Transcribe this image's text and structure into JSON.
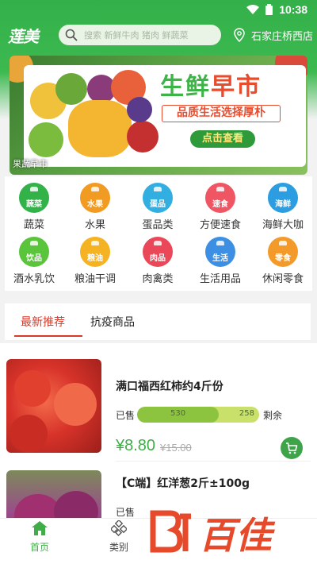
{
  "status_bar": {
    "time": "10:38"
  },
  "header": {
    "logo": "莲美",
    "search_placeholder": "搜索 新鲜牛肉 猪肉 鲜蔬菜",
    "location": "石家庄桥西店"
  },
  "banner": {
    "title_a": "生鲜",
    "title_b": "早市",
    "subtitle": "品质生活选择厚朴",
    "cta": "点击查看",
    "caption": "果蔬早市"
  },
  "categories": [
    {
      "badge": "蔬菜",
      "label": "蔬菜",
      "color": "#33b24a"
    },
    {
      "badge": "水果",
      "label": "水果",
      "color": "#f29b22"
    },
    {
      "badge": "蛋品",
      "label": "蛋品类",
      "color": "#33aee0"
    },
    {
      "badge": "速食",
      "label": "方便速食",
      "color": "#ef5563"
    },
    {
      "badge": "海鲜",
      "label": "海鲜大咖",
      "color": "#2b9de0"
    },
    {
      "badge": "饮品",
      "label": "酒水乳饮",
      "color": "#5ac43a"
    },
    {
      "badge": "粮油",
      "label": "粮油干调",
      "color": "#f5b324"
    },
    {
      "badge": "肉品",
      "label": "肉禽类",
      "color": "#ea4758"
    },
    {
      "badge": "生活",
      "label": "生活用品",
      "color": "#3d8fe4"
    },
    {
      "badge": "零食",
      "label": "休闲零食",
      "color": "#f49a2a"
    }
  ],
  "tabs": [
    {
      "label": "最新推荐",
      "active": true
    },
    {
      "label": "抗疫商品",
      "active": false
    }
  ],
  "products": [
    {
      "name": "满口福西红柿约4斤份",
      "sold_label": "已售",
      "sold": "530",
      "stock": "258",
      "remain_label": "剩余",
      "sold_fraction": 0.67,
      "price": "¥8.80",
      "original_price": "¥15.00"
    },
    {
      "name": "【C端】红洋葱2斤±100g",
      "sold_label": "已售"
    }
  ],
  "bottom_nav": [
    {
      "label": "首页",
      "active": true
    },
    {
      "label": "类别",
      "active": false
    }
  ],
  "watermark": "百佳",
  "colors": {
    "brand_green": "#3cb94f",
    "price_green": "#3fae48",
    "active_red": "#d83a2a"
  }
}
